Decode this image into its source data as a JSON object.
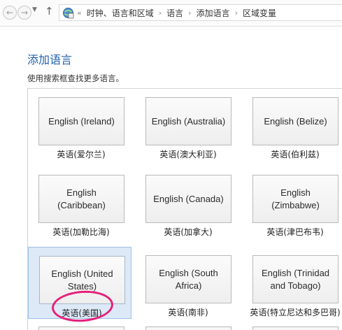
{
  "addressbar": {
    "back_icon": "back-arrow-icon",
    "forward_icon": "forward-arrow-icon",
    "recent_icon": "chevron-down-icon",
    "up_icon": "up-arrow-icon",
    "root_chevron": "«",
    "crumbs": [
      "时钟、语言和区域",
      "语言",
      "添加语言",
      "区域变量"
    ]
  },
  "page": {
    "title": "添加语言",
    "description": "使用搜索框查找更多语言。"
  },
  "languages": [
    {
      "name": "English (Ireland)",
      "label": "英语(爱尔兰)"
    },
    {
      "name": "English (Australia)",
      "label": "英语(澳大利亚)"
    },
    {
      "name": "English (Belize)",
      "label": "英语(伯利兹)"
    },
    {
      "name": "English (Caribbean)",
      "label": "英语(加勒比海)"
    },
    {
      "name": "English (Canada)",
      "label": "英语(加拿大)"
    },
    {
      "name": "English (Zimbabwe)",
      "label": "英语(津巴布韦)"
    },
    {
      "name": "English (United States)",
      "label": "英语(美国)"
    },
    {
      "name": "English (South Africa)",
      "label": "英语(南非)"
    },
    {
      "name": "English (Trinidad and Tobago)",
      "label": "英语(特立尼达和多巴哥)"
    }
  ],
  "selected_index": 6,
  "colors": {
    "title": "#1f5fa8",
    "selected_bg": "#dde9f6",
    "highlight": "#e6207a"
  }
}
